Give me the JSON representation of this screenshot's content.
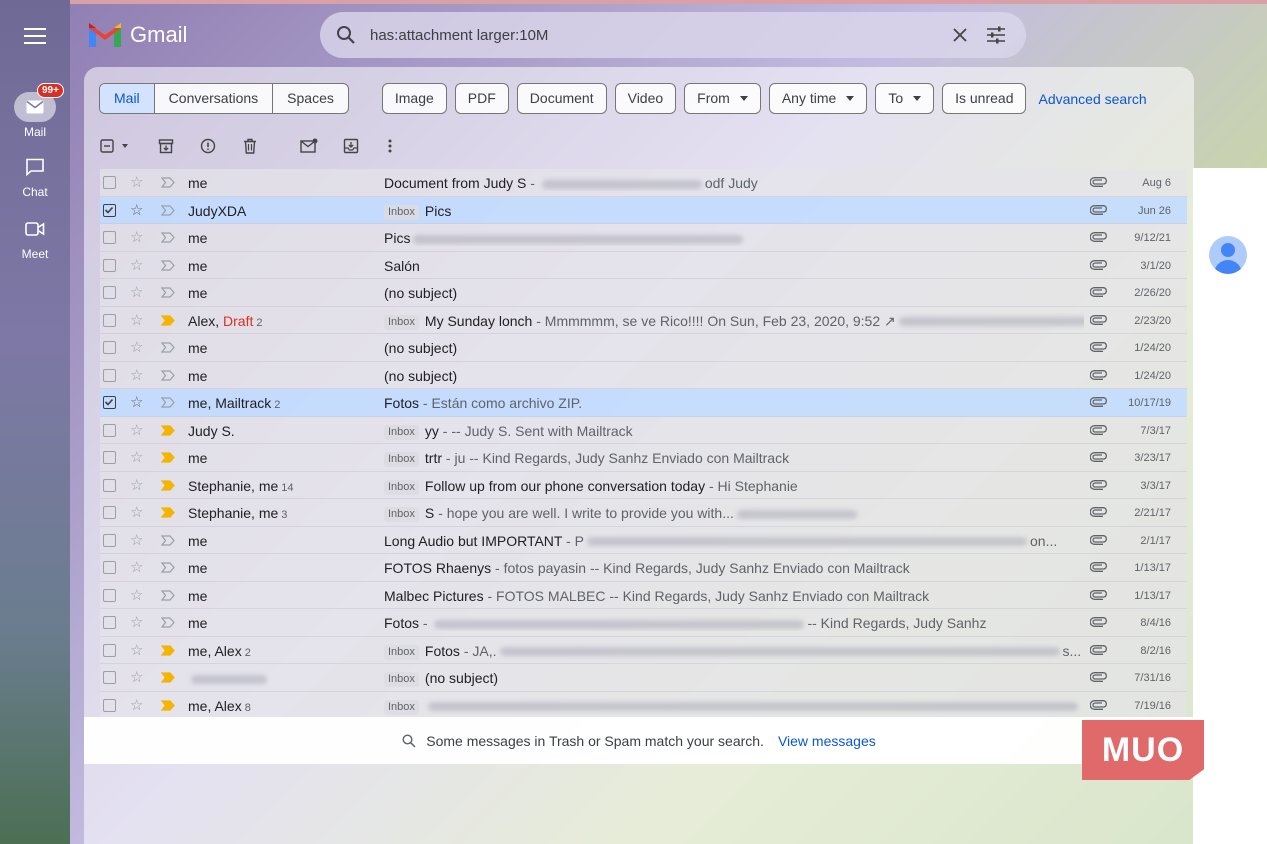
{
  "app": {
    "name": "Gmail"
  },
  "rail": {
    "mail_label": "Mail",
    "mail_badge": "99+",
    "chat_label": "Chat",
    "meet_label": "Meet"
  },
  "search": {
    "query": "has:attachment larger:10M"
  },
  "chips": {
    "segments": [
      "Mail",
      "Conversations",
      "Spaces"
    ],
    "filters": [
      "Image",
      "PDF",
      "Document",
      "Video"
    ],
    "dropdowns": [
      "From",
      "Any time",
      "To"
    ],
    "toggle": "Is unread",
    "advanced": "Advanced search"
  },
  "rows": [
    {
      "sender": "me",
      "subject": "Document from Judy S",
      "snippet": "odf Judy",
      "date": "Aug 6"
    },
    {
      "sender": "JudyXDA",
      "tag": "Inbox",
      "subject": "Pics",
      "date": "Jun 26"
    },
    {
      "sender": "me",
      "subject": "Pics",
      "date": "9/12/21"
    },
    {
      "sender": "me",
      "subject": "Salón",
      "date": "3/1/20"
    },
    {
      "sender": "me",
      "subject": "(no subject)",
      "date": "2/26/20"
    },
    {
      "sender": "Alex,",
      "draft": "Draft",
      "count": "2",
      "tag": "Inbox",
      "subject": "My Sunday lonch",
      "snippet": "Mmmmmm, se ve Rico!!!! On Sun, Feb 23, 2020, 9:52 ↗",
      "date": "2/23/20"
    },
    {
      "sender": "me",
      "subject": "(no subject)",
      "date": "1/24/20"
    },
    {
      "sender": "me",
      "subject": "(no subject)",
      "date": "1/24/20"
    },
    {
      "sender": "me, Mailtrack",
      "count": "2",
      "subject": "Fotos",
      "snippet": "Están como archivo ZIP.",
      "date": "10/17/19"
    },
    {
      "sender": "Judy S.",
      "tag": "Inbox",
      "subject": "yy",
      "snippet": "-- Judy S. Sent with Mailtrack",
      "date": "7/3/17"
    },
    {
      "sender": "me",
      "tag": "Inbox",
      "subject": "trtr",
      "snippet": "ju -- Kind Regards, Judy Sanhz Enviado con Mailtrack",
      "date": "3/23/17"
    },
    {
      "sender": "Stephanie, me",
      "count": "14",
      "tag": "Inbox",
      "subject": "Follow up from our phone conversation today",
      "snippet": "Hi Stephanie",
      "date": "3/3/17"
    },
    {
      "sender": "Stephanie, me",
      "count": "3",
      "tag": "Inbox",
      "subject": "S",
      "snippet": "hope you are well. I write to provide you with...",
      "date": "2/21/17"
    },
    {
      "sender": "me",
      "subject": "Long Audio but IMPORTANT",
      "snippet": "P",
      "snippet2": "on...",
      "date": "2/1/17"
    },
    {
      "sender": "me",
      "subject": "FOTOS Rhaenys",
      "snippet": "fotos payasin -- Kind Regards, Judy Sanhz Enviado con Mailtrack",
      "date": "1/13/17"
    },
    {
      "sender": "me",
      "subject": "Malbec Pictures",
      "snippet": "FOTOS MALBEC -- Kind Regards, Judy Sanhz Enviado con Mailtrack",
      "date": "1/13/17"
    },
    {
      "sender": "me",
      "subject": "Fotos",
      "snippet": "-- Kind Regards, Judy Sanhz",
      "date": "8/4/16"
    },
    {
      "sender": "me, Alex",
      "count": "2",
      "tag": "Inbox",
      "subject": "Fotos",
      "snippet": "JA,.",
      "snippet2": "s...",
      "date": "8/2/16"
    },
    {
      "sender": "",
      "tag": "Inbox",
      "subject": "(no subject)",
      "date": "7/31/16"
    },
    {
      "sender": "me, Alex",
      "count": "8",
      "tag": "Inbox",
      "date": "7/19/16"
    }
  ],
  "footer": {
    "text": "Some messages in Trash or Spam match your search.",
    "link": "View messages"
  },
  "watermark": "MUO",
  "colors": {
    "accent": "#0b57d0",
    "selected_row": "#c2dbff",
    "badge": "#d93025",
    "draft": "#d93025",
    "important_marker": "#f4b400"
  }
}
